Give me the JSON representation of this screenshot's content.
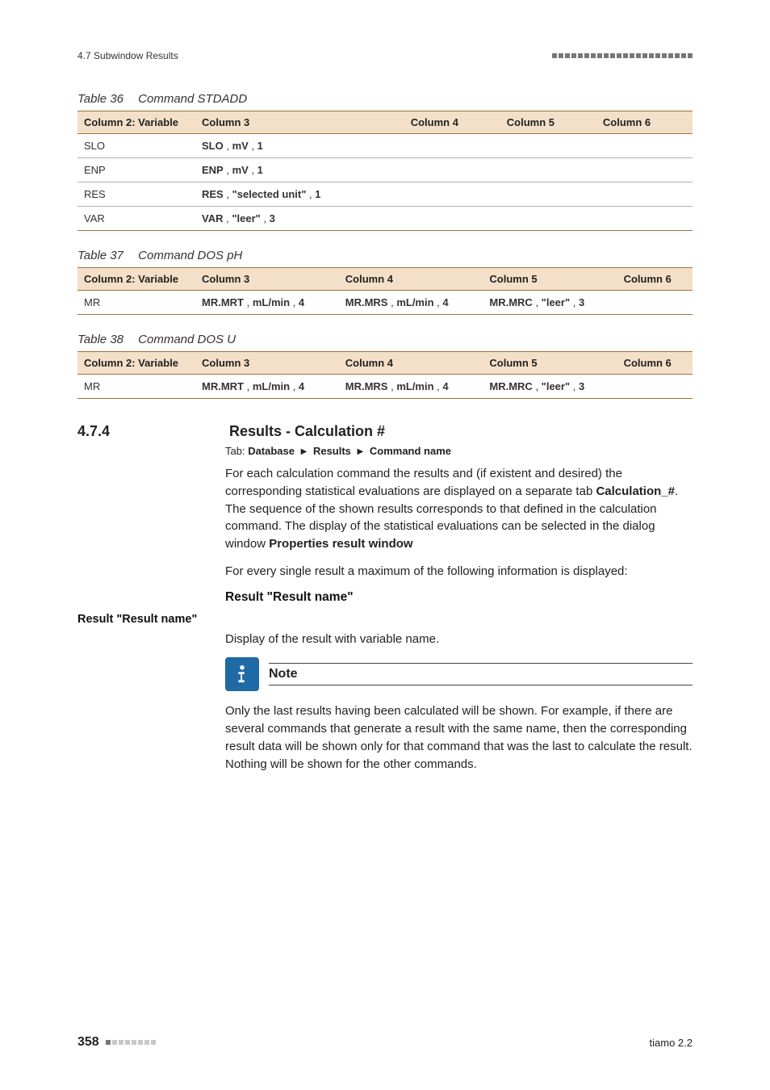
{
  "header": {
    "section_label": "4.7 Subwindow Results"
  },
  "table36": {
    "caption_num": "Table 36",
    "caption_title": "Command STDADD",
    "headers": [
      "Column 2: Variable",
      "Column 3",
      "Column 4",
      "Column 5",
      "Column 6"
    ],
    "rows": [
      {
        "c1": "SLO",
        "c3p": [
          {
            "b": "SLO"
          },
          {
            "t": " , "
          },
          {
            "b": "mV"
          },
          {
            "t": " , "
          },
          {
            "b": "1"
          }
        ]
      },
      {
        "c1": "ENP",
        "c3p": [
          {
            "b": "ENP"
          },
          {
            "t": " , "
          },
          {
            "b": "mV"
          },
          {
            "t": " , "
          },
          {
            "b": "1"
          }
        ]
      },
      {
        "c1": "RES",
        "c3p": [
          {
            "b": "RES"
          },
          {
            "t": " , "
          },
          {
            "b": "\"selected unit\""
          },
          {
            "t": " , "
          },
          {
            "b": "1"
          }
        ]
      },
      {
        "c1": "VAR",
        "c3p": [
          {
            "b": "VAR"
          },
          {
            "t": " , "
          },
          {
            "b": "\"leer\""
          },
          {
            "t": " , "
          },
          {
            "b": "3"
          }
        ]
      }
    ]
  },
  "table37": {
    "caption_num": "Table 37",
    "caption_title": "Command DOS pH",
    "headers": [
      "Column 2: Variable",
      "Column 3",
      "Column 4",
      "Column 5",
      "Column 6"
    ],
    "row": {
      "c1": "MR",
      "c3p": [
        {
          "b": "MR.MRT"
        },
        {
          "t": " , "
        },
        {
          "b": "mL/min"
        },
        {
          "t": " , "
        },
        {
          "b": "4"
        }
      ],
      "c4p": [
        {
          "b": "MR.MRS"
        },
        {
          "t": " , "
        },
        {
          "b": "mL/min"
        },
        {
          "t": " , "
        },
        {
          "b": "4"
        }
      ],
      "c5p": [
        {
          "b": "MR.MRC"
        },
        {
          "t": " , "
        },
        {
          "b": "\"leer\""
        },
        {
          "t": " , "
        },
        {
          "b": "3"
        }
      ]
    }
  },
  "table38": {
    "caption_num": "Table 38",
    "caption_title": "Command DOS U",
    "headers": [
      "Column 2: Variable",
      "Column 3",
      "Column 4",
      "Column 5",
      "Column 6"
    ],
    "row": {
      "c1": "MR",
      "c3p": [
        {
          "b": "MR.MRT"
        },
        {
          "t": " , "
        },
        {
          "b": "mL/min"
        },
        {
          "t": " , "
        },
        {
          "b": "4"
        }
      ],
      "c4p": [
        {
          "b": "MR.MRS"
        },
        {
          "t": " , "
        },
        {
          "b": "mL/min"
        },
        {
          "t": " , "
        },
        {
          "b": "4"
        }
      ],
      "c5p": [
        {
          "b": "MR.MRC"
        },
        {
          "t": " , "
        },
        {
          "b": "\"leer\""
        },
        {
          "t": " , "
        },
        {
          "b": "3"
        }
      ]
    }
  },
  "section": {
    "num": "4.7.4",
    "title": "Results - Calculation #",
    "tab_prefix": "Tab: ",
    "tab_parts": [
      "Database",
      "Results",
      "Command name"
    ],
    "para1_pre": "For each calculation command the results and (if existent and desired) the corresponding statistical evaluations are displayed on a separate tab ",
    "para1_bold": "Calculation_#",
    "para1_mid": ". The sequence of the shown results corresponds to that defined in the calculation command. The display of the statistical evaluations can be selected in the dialog window ",
    "para1_bold2": "Properties result window",
    "para2": "For every single result a maximum of the following information is displayed:",
    "subhead": "Result \"Result name\"",
    "margin_label": "Result \"Result name\"",
    "para3": "Display of the result with variable name.",
    "note_title": "Note",
    "note_text": "Only the last results having been calculated will be shown. For example, if there are several commands that generate a result with the same name, then the corresponding result data will be shown only for that command that was the last to calculate the result. Nothing will be shown for the other commands."
  },
  "footer": {
    "page": "358",
    "product": "tiamo 2.2"
  }
}
